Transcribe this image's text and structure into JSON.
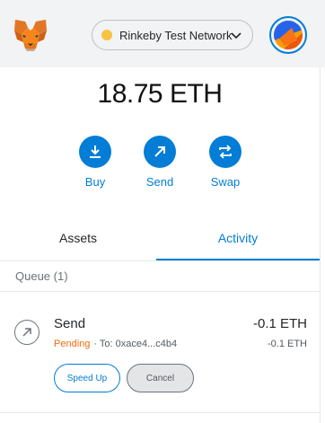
{
  "colors": {
    "accent": "#037dd6",
    "network_dot": "#f6c343",
    "pending": "#f66a0a"
  },
  "header": {
    "network_label": "Rinkeby Test Network",
    "logo_icon": "metamask-fox-icon",
    "network_chevron_icon": "chevron-down-icon",
    "avatar_icon": "account-avatar"
  },
  "balance": {
    "amount": "18.75 ETH"
  },
  "actions": [
    {
      "label": "Buy",
      "icon": "download-icon"
    },
    {
      "label": "Send",
      "icon": "arrow-up-right-icon"
    },
    {
      "label": "Swap",
      "icon": "swap-arrows-icon"
    }
  ],
  "tabs": [
    {
      "label": "Assets",
      "active": false
    },
    {
      "label": "Activity",
      "active": true
    }
  ],
  "activity": {
    "queue_label": "Queue (1)",
    "transactions": [
      {
        "title": "Send",
        "icon": "arrow-up-right-icon",
        "status": "Pending",
        "to_text": "· To: 0xace4...c4b4",
        "amount": "-0.1 ETH",
        "amount_secondary": "-0.1 ETH",
        "speed_up_label": "Speed Up",
        "cancel_label": "Cancel"
      }
    ]
  }
}
